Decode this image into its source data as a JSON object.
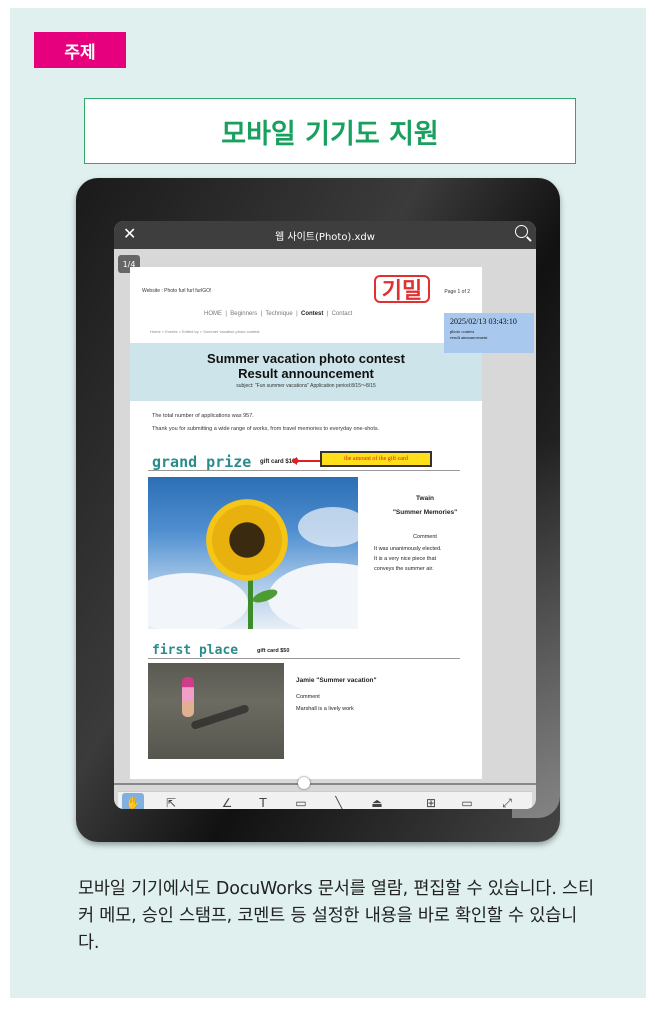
{
  "topic_tag": "주제",
  "title": "모바일 기기도 지원",
  "viewer": {
    "file_name": "웹 사이트(Photo).xdw",
    "page_indicator": "1/4",
    "icons": [
      "close-icon",
      "search-icon"
    ]
  },
  "document": {
    "website_line": "Website : Photo furl furl furlGO!",
    "page_of": "Page 1 of 2",
    "stamp_text": "기밀",
    "nav": [
      "HOME",
      "Beginners",
      "Technique",
      "Contest",
      "Contact"
    ],
    "breadcrumb": "Home  >  Events  >  Edited by  >  Summer vacation photo contest",
    "heading1": "Summer vacation photo contest",
    "heading2": "Result announcement",
    "subject": "subject: \"Fun summer vacations\" Application period:8/15～8/15",
    "intro1": "The total number of applications was 957.",
    "intro2": "Thank you for submitting a wide range of works, from travel memories to everyday one-shots.",
    "grand_prize_label": "grand prize",
    "grand_prize_gift": "gift card $100",
    "callout": "the amount of the gift card",
    "winner_name": "Twain",
    "winner_title": "\"Summer Memories\"",
    "winner_comment_label": "Comment",
    "winner_comment": [
      "It was unanimously elected.",
      "It is a very nice piece that",
      "conveys the summer air."
    ],
    "first_place_label": "first place",
    "first_place_gift": "gift card $50",
    "first_name_title": "Jamie  \"Summer vacation\"",
    "first_comment_label": "Comment",
    "first_comment": "Marshall is a lively work"
  },
  "sticky_note": {
    "datetime": "2025/02/13 03:43:10",
    "line1": "photo contest",
    "line2": "result announcement"
  },
  "toolbar": {
    "tools": [
      "hand-icon",
      "select-arrow-icon",
      "pen-icon",
      "text-icon",
      "rectangle-icon",
      "line-icon",
      "stamp-icon",
      "grid-icon",
      "annotation-rect-icon",
      "expand-icon"
    ],
    "text_glyph": "T"
  },
  "description": "모바일 기기에서도 DocuWorks 문서를 열람, 편집할 수 있습니다. 스티커 메모, 승인 스탬프, 코멘트 등 설정한 내용을 바로 확인할 수 있습니다."
}
